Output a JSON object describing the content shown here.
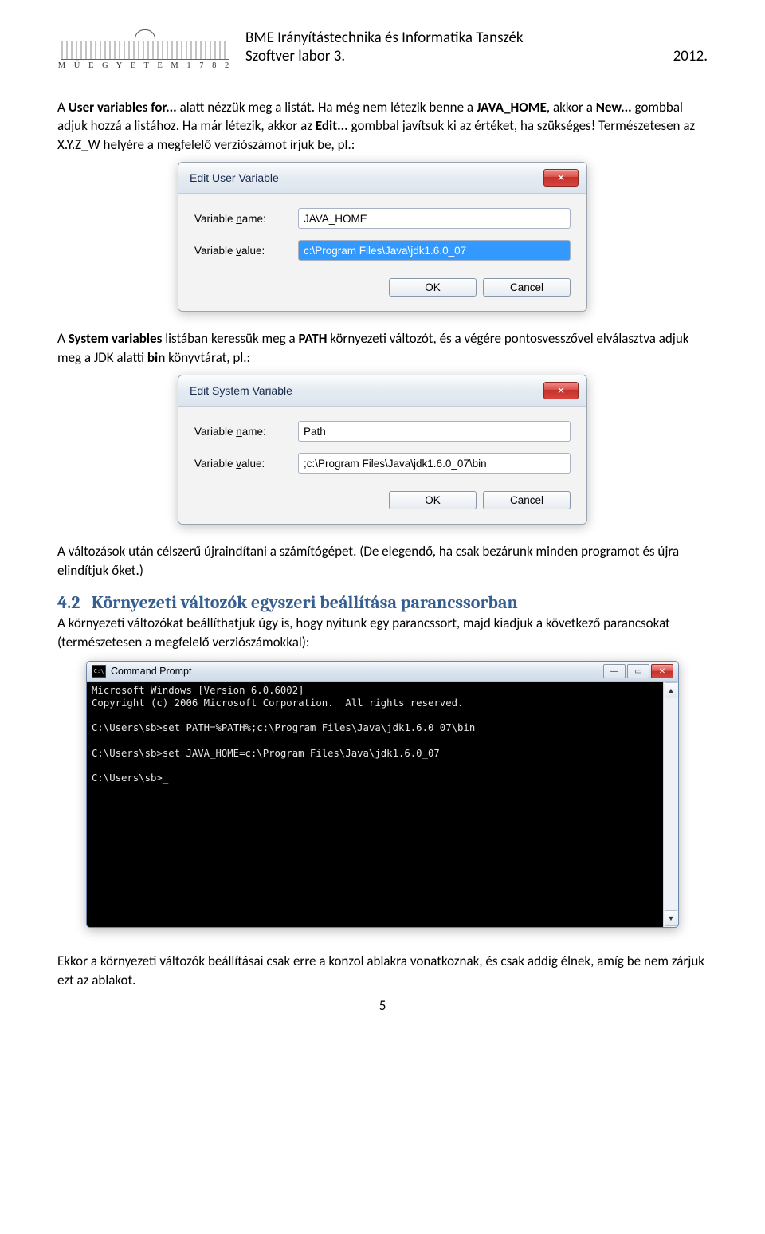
{
  "header": {
    "logo_text": "M Ű E G Y E T E M   1 7 8 2",
    "line1": "BME Irányítástechnika és Informatika Tanszék",
    "line2_left": "Szoftver labor 3.",
    "line2_right": "2012."
  },
  "para1": {
    "t1": "A ",
    "b1": "User variables for...",
    "t2": " alatt nézzük meg a listát. Ha még nem létezik benne a ",
    "b2": "JAVA_HOME",
    "t3": ", akkor a ",
    "b3": "New...",
    "t4": " gombbal adjuk hozzá a listához. Ha már létezik, akkor az ",
    "b4": "Edit...",
    "t5": " gombbal javítsuk ki az értéket, ha szükséges! Természetesen az X.Y.Z_W helyére a megfelelő verziószámot írjuk be, pl.:"
  },
  "dialog1": {
    "title": "Edit User Variable",
    "label_name_pre": "Variable ",
    "label_name_u": "n",
    "label_name_post": "ame:",
    "label_val_pre": "Variable ",
    "label_val_u": "v",
    "label_val_post": "alue:",
    "name_value": "JAVA_HOME",
    "value_value": "c:\\Program Files\\Java\\jdk1.6.0_07",
    "ok": "OK",
    "cancel": "Cancel"
  },
  "para2": {
    "t1": "A ",
    "b1": "System variables",
    "t2": " listában keressük meg a ",
    "b2": "PATH",
    "t3": " környezeti változót, és a végére pontosvesszővel elválasztva adjuk meg a JDK alatti ",
    "b3": "bin",
    "t4": " könyvtárat, pl.:"
  },
  "dialog2": {
    "title": "Edit System Variable",
    "name_value": "Path",
    "value_value": ";c:\\Program Files\\Java\\jdk1.6.0_07\\bin",
    "ok": "OK",
    "cancel": "Cancel"
  },
  "para3": "A változások után célszerű újraindítani a számítógépet. (De elegendő, ha csak bezárunk minden programot és újra elindítjuk őket.)",
  "section": {
    "num": "4.2",
    "title": "Környezeti változók egyszeri beállítása parancssorban"
  },
  "para4": "A környezeti változókat beállíthatjuk úgy is, hogy nyitunk egy parancssort, majd kiadjuk a következő parancsokat (természetesen a megfelelő verziószámokkal):",
  "cmd": {
    "title": "Command Prompt",
    "lines": "Microsoft Windows [Version 6.0.6002]\nCopyright (c) 2006 Microsoft Corporation.  All rights reserved.\n\nC:\\Users\\sb>set PATH=%PATH%;c:\\Program Files\\Java\\jdk1.6.0_07\\bin\n\nC:\\Users\\sb>set JAVA_HOME=c:\\Program Files\\Java\\jdk1.6.0_07\n\nC:\\Users\\sb>_"
  },
  "para5": "Ekkor a környezeti változók beállításai csak erre a konzol ablakra vonatkoznak, és csak addig élnek, amíg be nem zárjuk ezt az ablakot.",
  "page_number": "5"
}
